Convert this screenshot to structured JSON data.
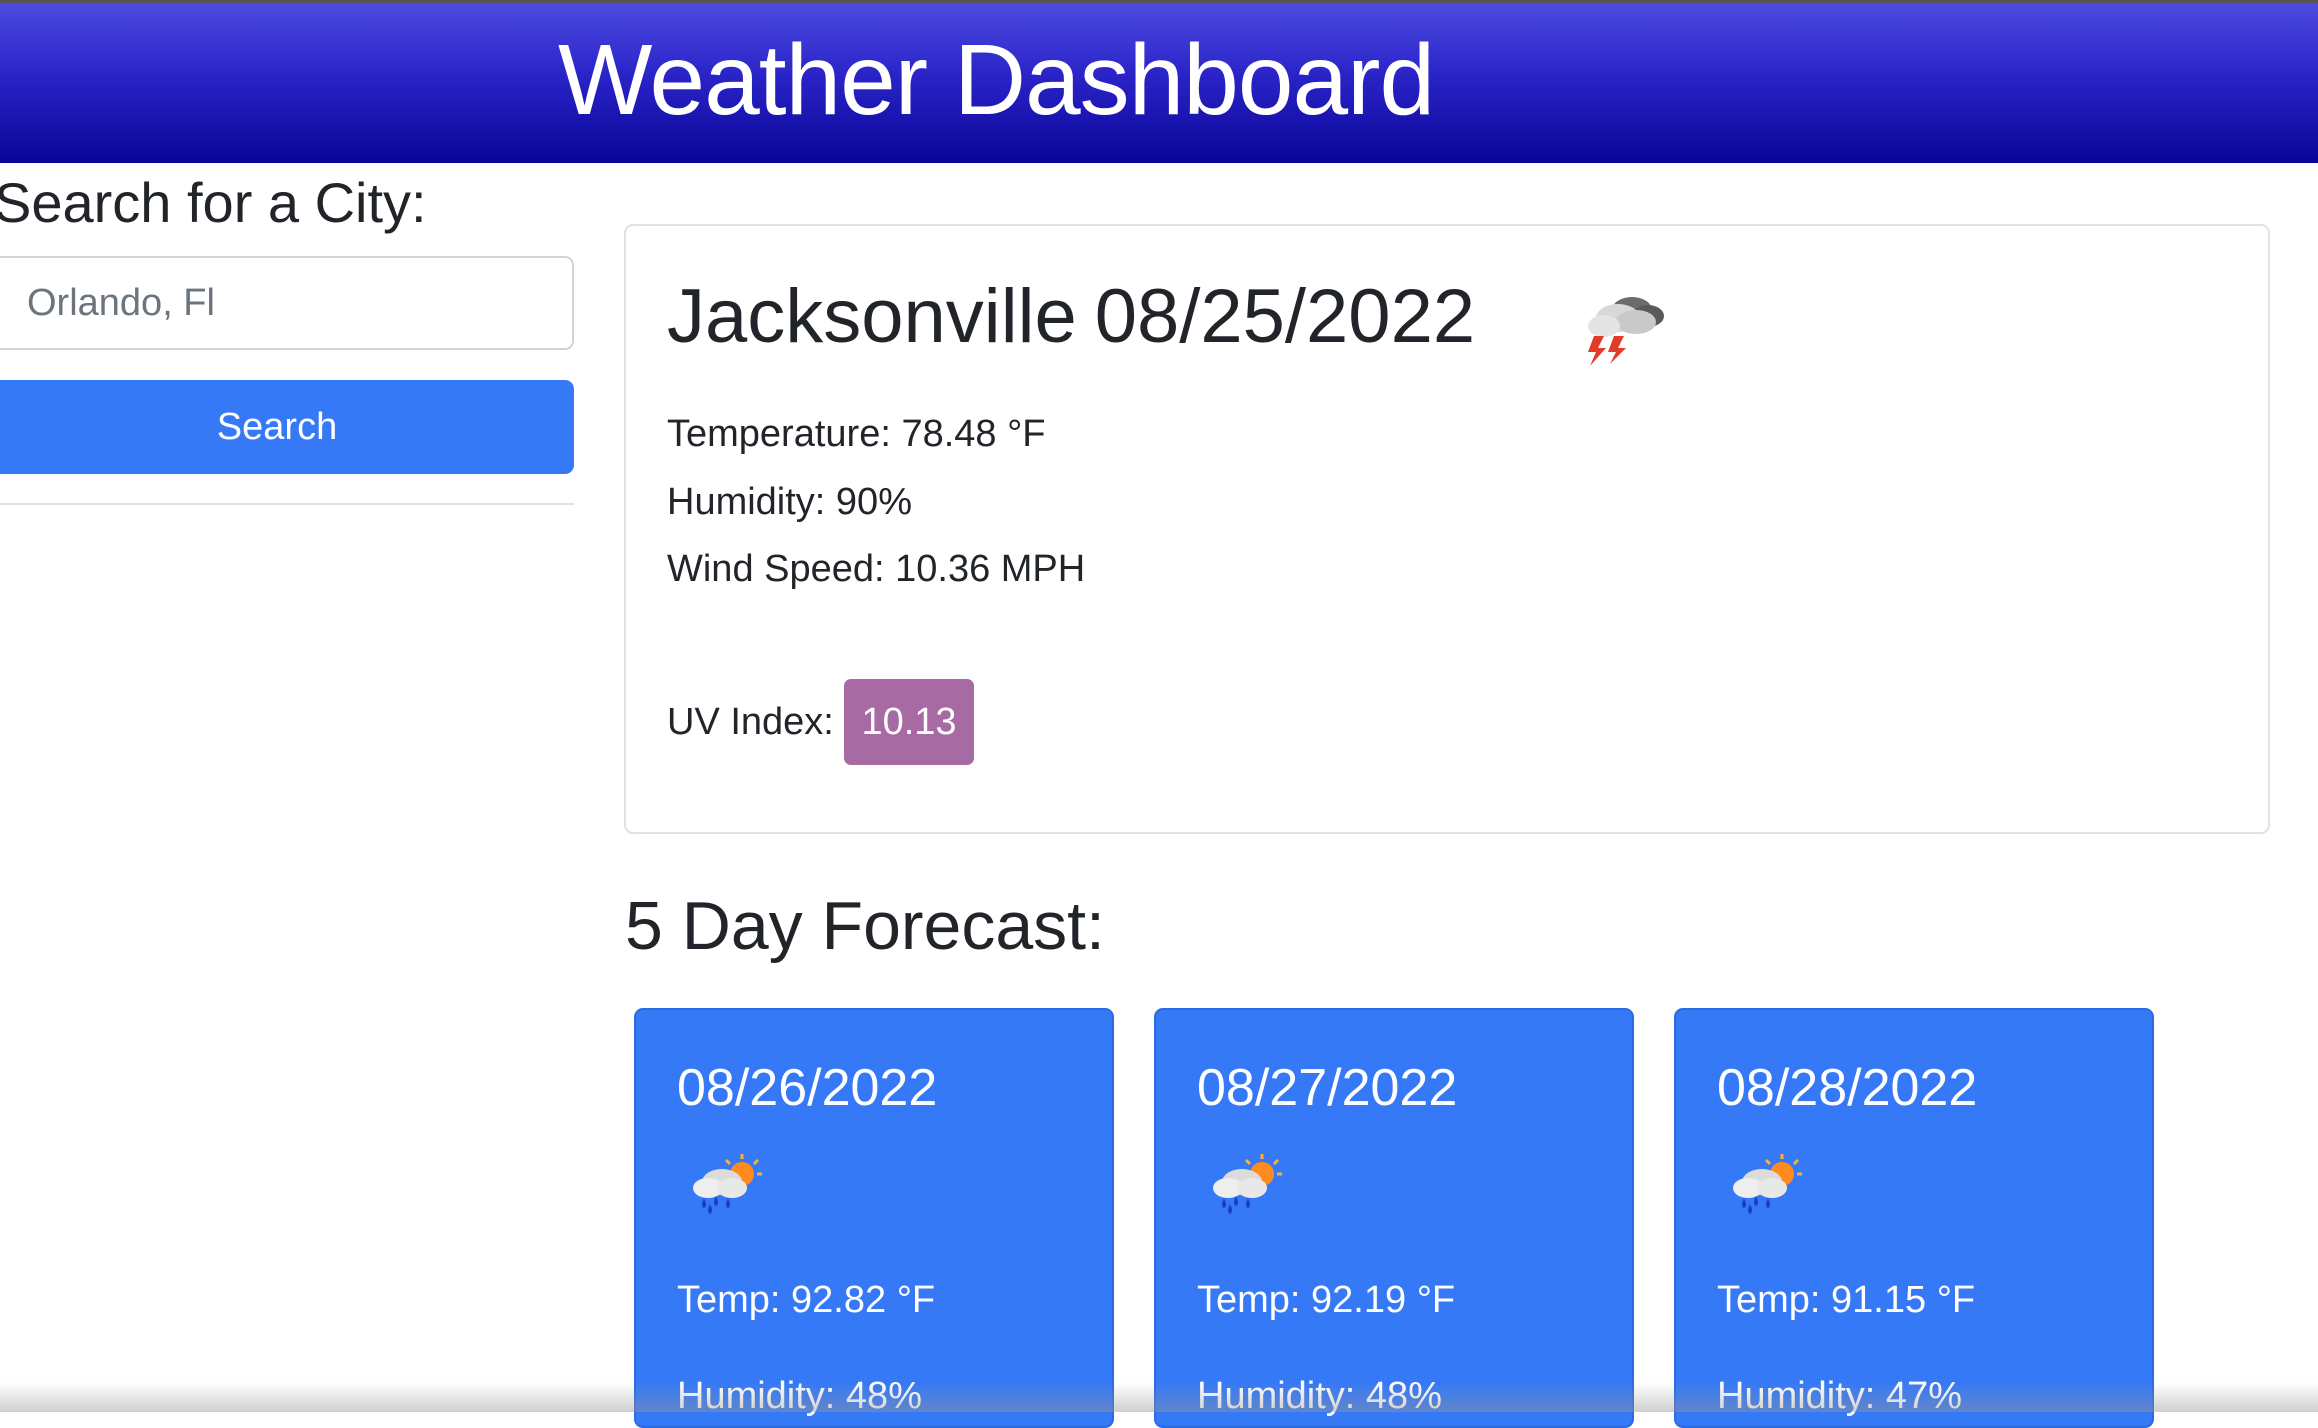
{
  "header": {
    "title": "Weather Dashboard"
  },
  "sidebar": {
    "heading": "Search for a City:",
    "search_value": "Orlando, Fl",
    "search_button_label": "Search"
  },
  "current": {
    "city": "Jacksonville",
    "date": "08/25/2022",
    "icon": "thunderstorm-icon",
    "temperature_label": "Temperature: 78.48 °F",
    "humidity_label": "Humidity: 90%",
    "wind_label": "Wind Speed: 10.36 MPH",
    "uv_label": "UV Index:",
    "uv_value": "10.13",
    "uv_color": "#a86aa3"
  },
  "forecast": {
    "heading": "5 Day Forecast:",
    "accent_color": "#3579f6",
    "days": [
      {
        "date": "08/26/2022",
        "icon": "rain-sun-icon",
        "temp": "Temp: 92.82 °F",
        "humidity": "Humidity: 48%"
      },
      {
        "date": "08/27/2022",
        "icon": "rain-sun-icon",
        "temp": "Temp: 92.19 °F",
        "humidity": "Humidity: 48%"
      },
      {
        "date": "08/28/2022",
        "icon": "rain-sun-icon",
        "temp": "Temp: 91.15 °F",
        "humidity": "Humidity: 47%"
      }
    ]
  }
}
